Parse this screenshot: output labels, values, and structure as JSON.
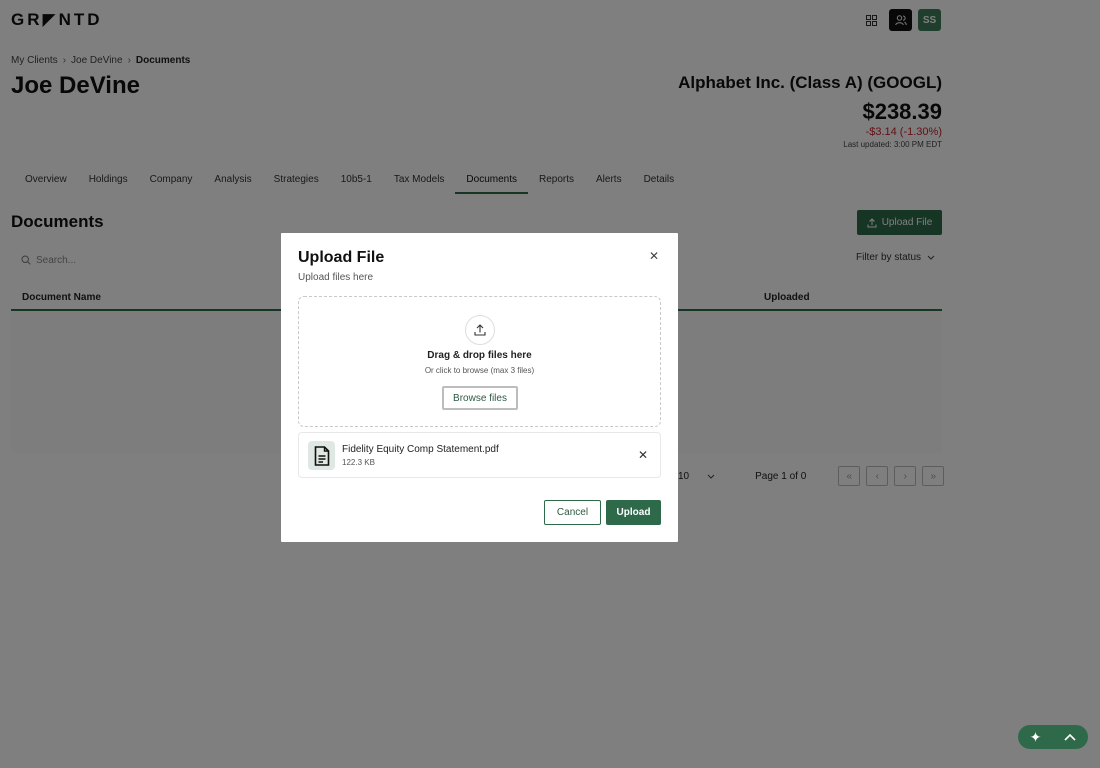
{
  "app": {
    "logo": "GR◤NTD",
    "avatar_initials": "SS"
  },
  "breadcrumb": {
    "items": [
      "My Clients",
      "Joe DeVine",
      "Documents"
    ]
  },
  "client": {
    "name": "Joe DeVine"
  },
  "ticker": {
    "name": "Alphabet Inc. (Class A) (GOOGL)",
    "price": "$238.39",
    "change": "-$3.14  (-1.30%)",
    "updated": "Last updated: 3:00 PM EDT"
  },
  "tabs": [
    {
      "label": "Overview"
    },
    {
      "label": "Holdings"
    },
    {
      "label": "Company"
    },
    {
      "label": "Analysis"
    },
    {
      "label": "Strategies"
    },
    {
      "label": "10b5-1"
    },
    {
      "label": "Tax Models"
    },
    {
      "label": "Documents"
    },
    {
      "label": "Reports"
    },
    {
      "label": "Alerts"
    },
    {
      "label": "Details"
    }
  ],
  "documents": {
    "title": "Documents",
    "upload_button": "Upload File",
    "search_placeholder": "Search...",
    "filter_label": "Filter by status",
    "columns": {
      "name": "Document Name",
      "uploaded": "Uploaded"
    }
  },
  "pagination": {
    "rows_value": "10",
    "page_info": "Page 1 of 0"
  },
  "modal": {
    "title": "Upload File",
    "subtitle": "Upload files here",
    "drop_main": "Drag & drop files here",
    "drop_sub": "Or click to browse (max 3 files)",
    "browse_label": "Browse files",
    "file": {
      "name": "Fidelity Equity Comp Statement.pdf",
      "size": "122.3 KB"
    },
    "cancel_label": "Cancel",
    "submit_label": "Upload"
  },
  "colors": {
    "accent": "#2e6a4a",
    "negative": "#c81f2b"
  }
}
